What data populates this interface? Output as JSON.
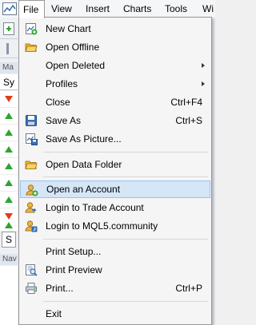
{
  "menubar": {
    "items": [
      {
        "label": "File",
        "active": true
      },
      {
        "label": "View"
      },
      {
        "label": "Insert"
      },
      {
        "label": "Charts"
      },
      {
        "label": "Tools"
      },
      {
        "label": "Wi"
      }
    ]
  },
  "background": {
    "market_watch_title": "Ma",
    "market_watch_header": "Sy",
    "tab_label": "S",
    "navigator_title": "Nav",
    "arrows": [
      "down",
      "up",
      "up",
      "up",
      "up",
      "up",
      "up",
      "up",
      "down",
      "up"
    ]
  },
  "file_menu": {
    "items": [
      {
        "label": "New Chart",
        "icon": "new-chart-icon"
      },
      {
        "label": "Open Offline",
        "icon": "open-folder-icon"
      },
      {
        "label": "Open Deleted",
        "submenu": true
      },
      {
        "label": "Profiles",
        "submenu": true
      },
      {
        "label": "Close",
        "shortcut": "Ctrl+F4"
      },
      {
        "label": "Save As",
        "shortcut": "Ctrl+S",
        "icon": "floppy-disk-icon"
      },
      {
        "label": "Save As Picture...",
        "icon": "save-picture-icon"
      },
      {
        "label": "Open Data Folder",
        "icon": "folder-icon"
      },
      {
        "label": "Open an Account",
        "icon": "add-account-icon",
        "highlighted": true
      },
      {
        "label": "Login to Trade Account",
        "icon": "login-account-icon"
      },
      {
        "label": "Login to MQL5.community",
        "icon": "mql5-community-icon"
      },
      {
        "label": "Print Setup..."
      },
      {
        "label": "Print Preview",
        "icon": "print-preview-icon"
      },
      {
        "label": "Print...",
        "shortcut": "Ctrl+P",
        "icon": "printer-icon"
      },
      {
        "label": "Exit"
      }
    ]
  },
  "colors": {
    "highlight_fill": "#d5e6f7",
    "highlight_border": "#99c2eb",
    "arrow_up": "#2ea52e",
    "arrow_down": "#e03c18"
  }
}
